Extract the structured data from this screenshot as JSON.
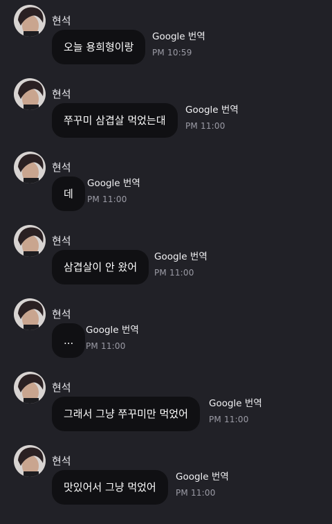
{
  "messages": [
    {
      "sender": "현석",
      "text": "오늘 용희형이랑",
      "translate_label": "Google 번역",
      "time": "PM 10:59"
    },
    {
      "sender": "현석",
      "text": "쭈꾸미 삼겹살 먹었는대",
      "translate_label": "Google 번역",
      "time": "PM 11:00"
    },
    {
      "sender": "현석",
      "text": "데",
      "translate_label": "Google 번역",
      "time": "PM 11:00"
    },
    {
      "sender": "현석",
      "text": "삼겹살이 안 왔어",
      "translate_label": "Google 번역",
      "time": "PM 11:00"
    },
    {
      "sender": "현석",
      "text": "...",
      "translate_label": "Google 번역",
      "time": "PM 11:00"
    },
    {
      "sender": "현석",
      "text": "그래서 그냥 쭈꾸미만 먹었어",
      "translate_label": "Google 번역",
      "time": "PM 11:00"
    },
    {
      "sender": "현석",
      "text": "맛있어서 그냥 먹었어",
      "translate_label": "Google 번역",
      "time": "PM 11:00"
    }
  ],
  "icons": {
    "avatar": "avatar-photo"
  },
  "colors": {
    "background": "#212127",
    "bubble": "#101013",
    "text": "#ffffff",
    "timestamp": "#9c9ca6"
  }
}
